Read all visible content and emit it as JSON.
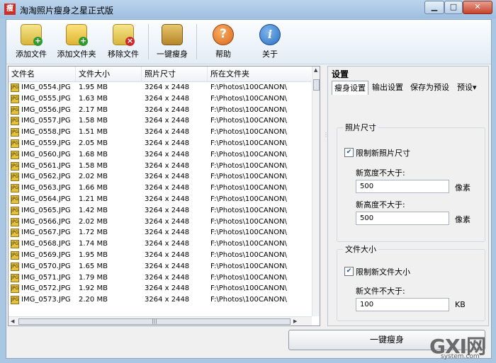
{
  "window": {
    "title": "淘淘照片瘦身之星正式版",
    "icon_text": "瘦"
  },
  "toolbar": {
    "add_file": "添加文件",
    "add_folder": "添加文件夹",
    "remove_file": "移除文件",
    "one_click_slim": "一键瘦身",
    "help": "帮助",
    "about": "关于"
  },
  "list": {
    "headers": [
      "文件名",
      "文件大小",
      "照片尺寸",
      "所在文件夹"
    ],
    "rows": [
      {
        "name": "IMG_0554.JPG",
        "size": "1.95 MB",
        "dims": "3264 x 2448",
        "folder": "F:\\Photos\\100CANON\\"
      },
      {
        "name": "IMG_0555.JPG",
        "size": "1.63 MB",
        "dims": "3264 x 2448",
        "folder": "F:\\Photos\\100CANON\\"
      },
      {
        "name": "IMG_0556.JPG",
        "size": "2.17 MB",
        "dims": "3264 x 2448",
        "folder": "F:\\Photos\\100CANON\\"
      },
      {
        "name": "IMG_0557.JPG",
        "size": "1.58 MB",
        "dims": "3264 x 2448",
        "folder": "F:\\Photos\\100CANON\\"
      },
      {
        "name": "IMG_0558.JPG",
        "size": "1.51 MB",
        "dims": "3264 x 2448",
        "folder": "F:\\Photos\\100CANON\\"
      },
      {
        "name": "IMG_0559.JPG",
        "size": "2.05 MB",
        "dims": "3264 x 2448",
        "folder": "F:\\Photos\\100CANON\\"
      },
      {
        "name": "IMG_0560.JPG",
        "size": "1.68 MB",
        "dims": "3264 x 2448",
        "folder": "F:\\Photos\\100CANON\\"
      },
      {
        "name": "IMG_0561.JPG",
        "size": "1.58 MB",
        "dims": "3264 x 2448",
        "folder": "F:\\Photos\\100CANON\\"
      },
      {
        "name": "IMG_0562.JPG",
        "size": "2.02 MB",
        "dims": "3264 x 2448",
        "folder": "F:\\Photos\\100CANON\\"
      },
      {
        "name": "IMG_0563.JPG",
        "size": "1.66 MB",
        "dims": "3264 x 2448",
        "folder": "F:\\Photos\\100CANON\\"
      },
      {
        "name": "IMG_0564.JPG",
        "size": "1.21 MB",
        "dims": "3264 x 2448",
        "folder": "F:\\Photos\\100CANON\\"
      },
      {
        "name": "IMG_0565.JPG",
        "size": "1.42 MB",
        "dims": "3264 x 2448",
        "folder": "F:\\Photos\\100CANON\\"
      },
      {
        "name": "IMG_0566.JPG",
        "size": "2.02 MB",
        "dims": "3264 x 2448",
        "folder": "F:\\Photos\\100CANON\\"
      },
      {
        "name": "IMG_0567.JPG",
        "size": "1.72 MB",
        "dims": "3264 x 2448",
        "folder": "F:\\Photos\\100CANON\\"
      },
      {
        "name": "IMG_0568.JPG",
        "size": "1.74 MB",
        "dims": "3264 x 2448",
        "folder": "F:\\Photos\\100CANON\\"
      },
      {
        "name": "IMG_0569.JPG",
        "size": "1.95 MB",
        "dims": "3264 x 2448",
        "folder": "F:\\Photos\\100CANON\\"
      },
      {
        "name": "IMG_0570.JPG",
        "size": "1.65 MB",
        "dims": "3264 x 2448",
        "folder": "F:\\Photos\\100CANON\\"
      },
      {
        "name": "IMG_0571.JPG",
        "size": "1.79 MB",
        "dims": "3264 x 2448",
        "folder": "F:\\Photos\\100CANON\\"
      },
      {
        "name": "IMG_0572.JPG",
        "size": "1.92 MB",
        "dims": "3264 x 2448",
        "folder": "F:\\Photos\\100CANON\\"
      },
      {
        "name": "IMG_0573.JPG",
        "size": "2.20 MB",
        "dims": "3264 x 2448",
        "folder": "F:\\Photos\\100CANON\\"
      }
    ]
  },
  "settings": {
    "title": "设置",
    "tabs": [
      "瘦身设置",
      "输出设置",
      "保存为预设",
      "预设▾"
    ],
    "photo_size": {
      "group_label": "照片尺寸",
      "limit_label": "限制新照片尺寸",
      "limit_checked": true,
      "width_label": "新宽度不大于:",
      "width_value": "500",
      "width_unit": "像素",
      "height_label": "新高度不大于:",
      "height_value": "500",
      "height_unit": "像素"
    },
    "file_size": {
      "group_label": "文件大小",
      "limit_label": "限制新文件大小",
      "limit_checked": true,
      "max_label": "新文件不大于:",
      "max_value": "100",
      "max_unit": "KB"
    }
  },
  "bottom": {
    "slim_button": "一键瘦身"
  },
  "watermark": {
    "big": "GXI网",
    "small": "system.com"
  }
}
